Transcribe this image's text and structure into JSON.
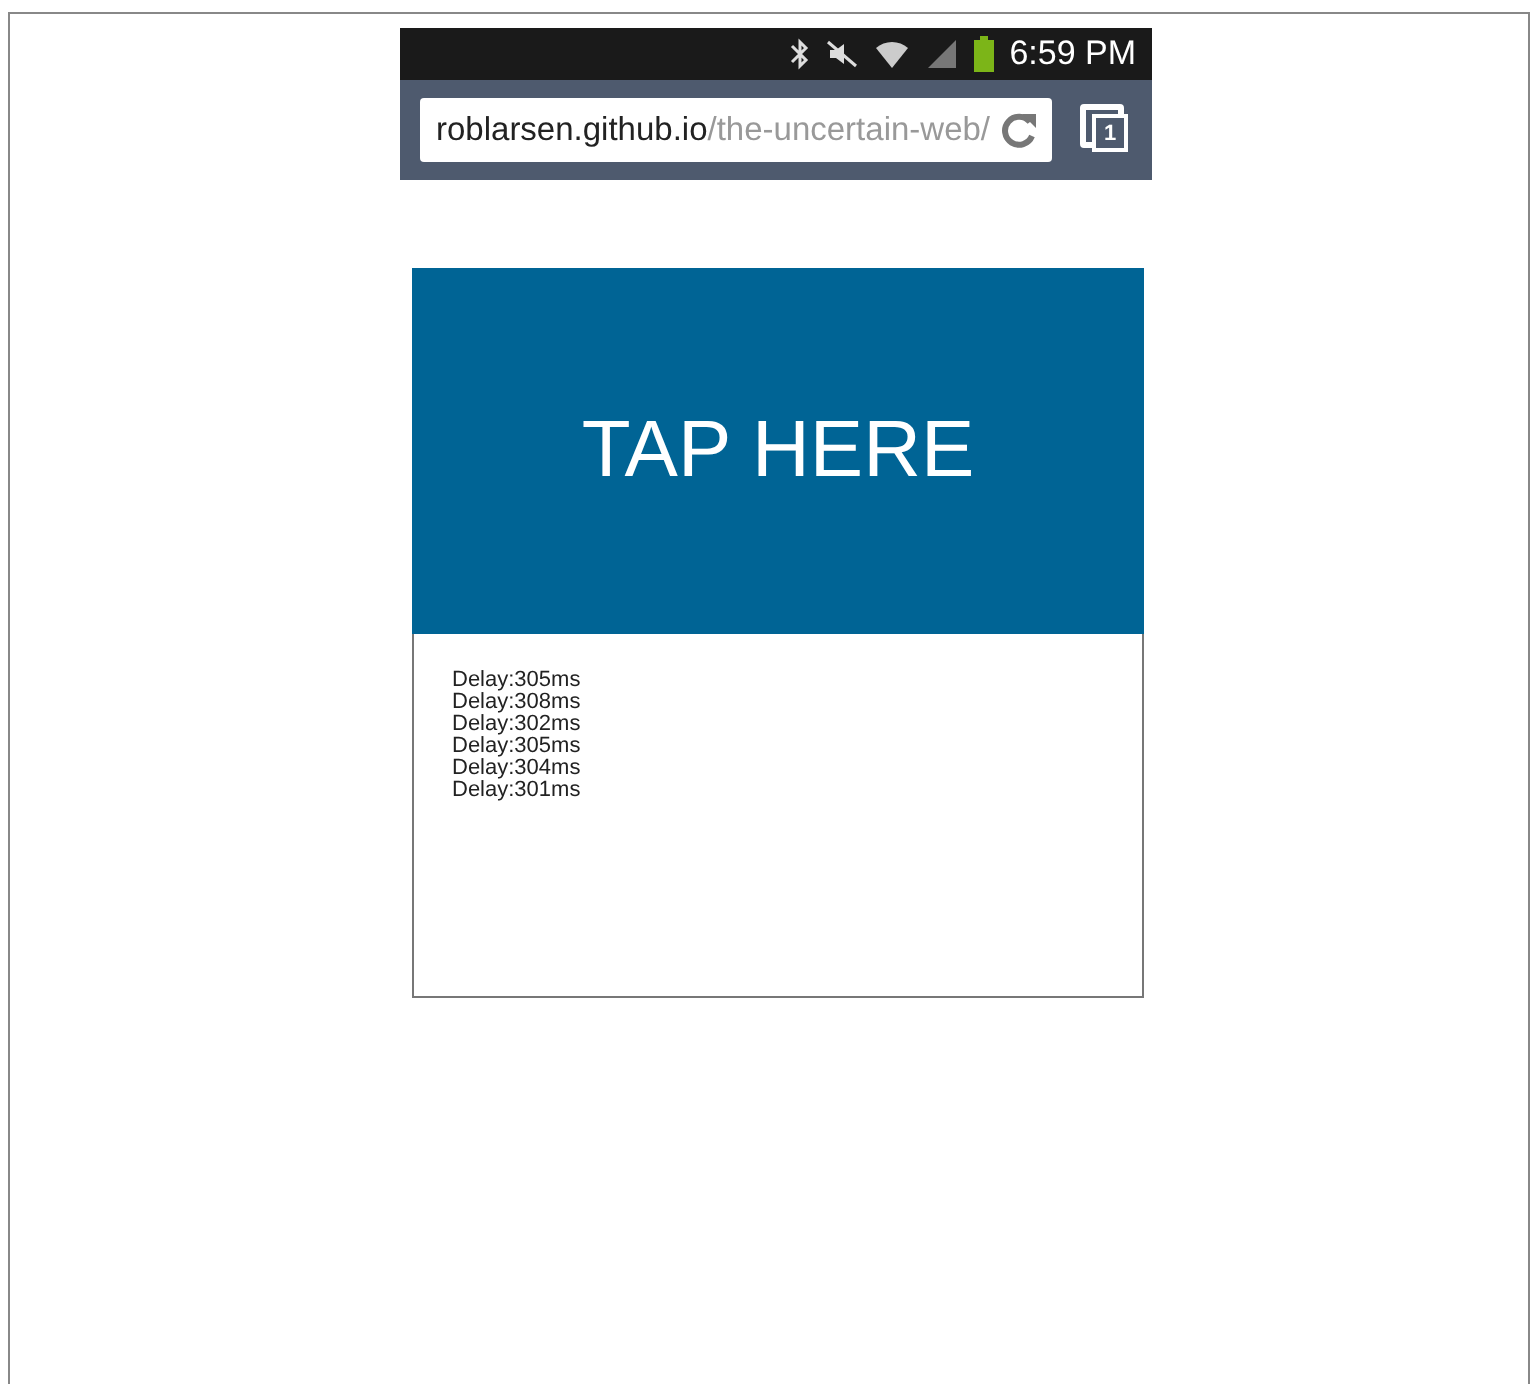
{
  "status_bar": {
    "time": "6:59 PM"
  },
  "address_bar": {
    "domain": "roblarsen.github.io",
    "path": "/the-uncertain-web/",
    "tab_count": "1"
  },
  "tap_area": {
    "label": "TAP HERE"
  },
  "log": [
    "Delay:305ms",
    "Delay:308ms",
    "Delay:302ms",
    "Delay:305ms",
    "Delay:304ms",
    "Delay:301ms"
  ]
}
